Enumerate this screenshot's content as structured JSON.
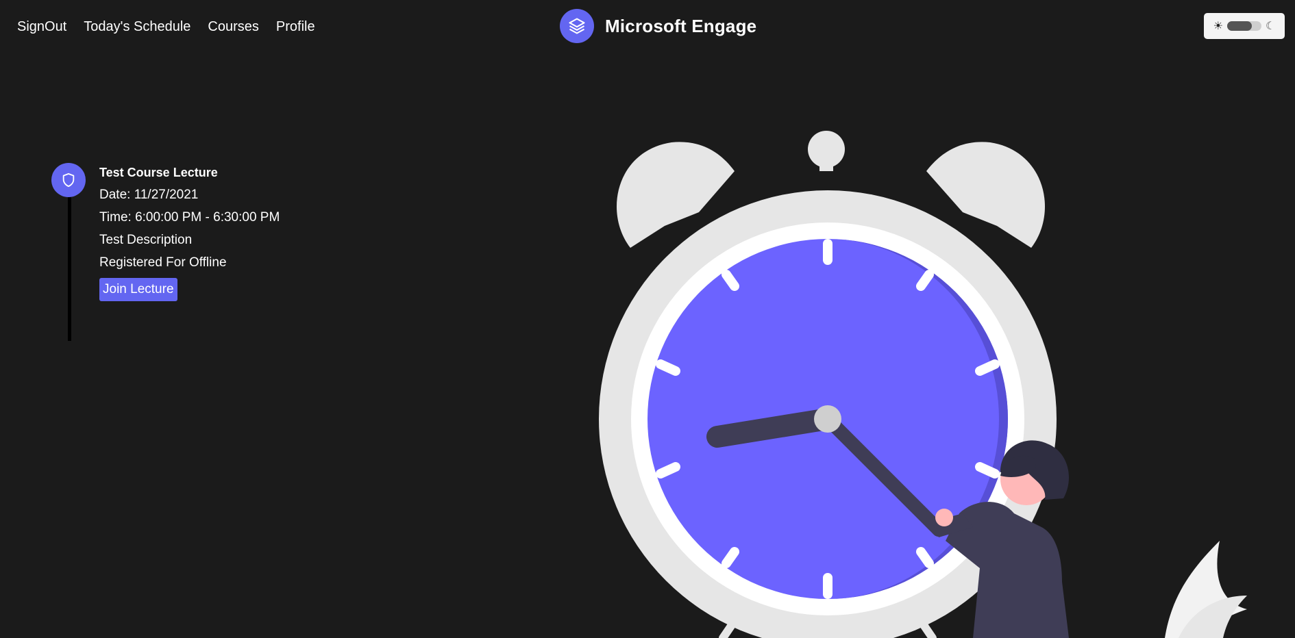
{
  "nav": {
    "links": [
      "SignOut",
      "Today's Schedule",
      "Courses",
      "Profile"
    ]
  },
  "brand": {
    "name": "Microsoft Engage",
    "icon": "layers-icon",
    "color": "#6366f1"
  },
  "theme_toggle": {
    "sun_icon": "sun-icon",
    "moon_icon": "moon-icon",
    "sun_glyph": "☀",
    "moon_glyph": "☾"
  },
  "event": {
    "title": "Test Course Lecture",
    "date": "Date: 11/27/2021",
    "time": "Time: 6:00:00 PM - 6:30:00 PM",
    "description": "Test Description",
    "registration": "Registered For Offline",
    "join_label": "Join Lecture",
    "icon": "shield-icon"
  },
  "colors": {
    "background": "#1b1b1b",
    "accent": "#6366f1",
    "clock_face": "#6c63ff"
  }
}
